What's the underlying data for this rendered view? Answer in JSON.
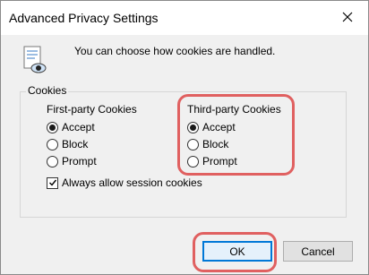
{
  "dialog": {
    "title": "Advanced Privacy Settings",
    "close_icon": "close-icon",
    "info_icon": "privacy-document-eye-icon",
    "info_text": "You can choose how cookies are handled."
  },
  "cookies": {
    "group_label": "Cookies",
    "first_party": {
      "title": "First-party Cookies",
      "options": [
        "Accept",
        "Block",
        "Prompt"
      ],
      "selected": "Accept"
    },
    "third_party": {
      "title": "Third-party Cookies",
      "options": [
        "Accept",
        "Block",
        "Prompt"
      ],
      "selected": "Accept"
    },
    "session_checkbox_label": "Always allow session cookies",
    "session_checkbox_checked": true
  },
  "buttons": {
    "ok": "OK",
    "cancel": "Cancel"
  },
  "colors": {
    "highlight": "#e06060",
    "accent": "#0078d7"
  }
}
